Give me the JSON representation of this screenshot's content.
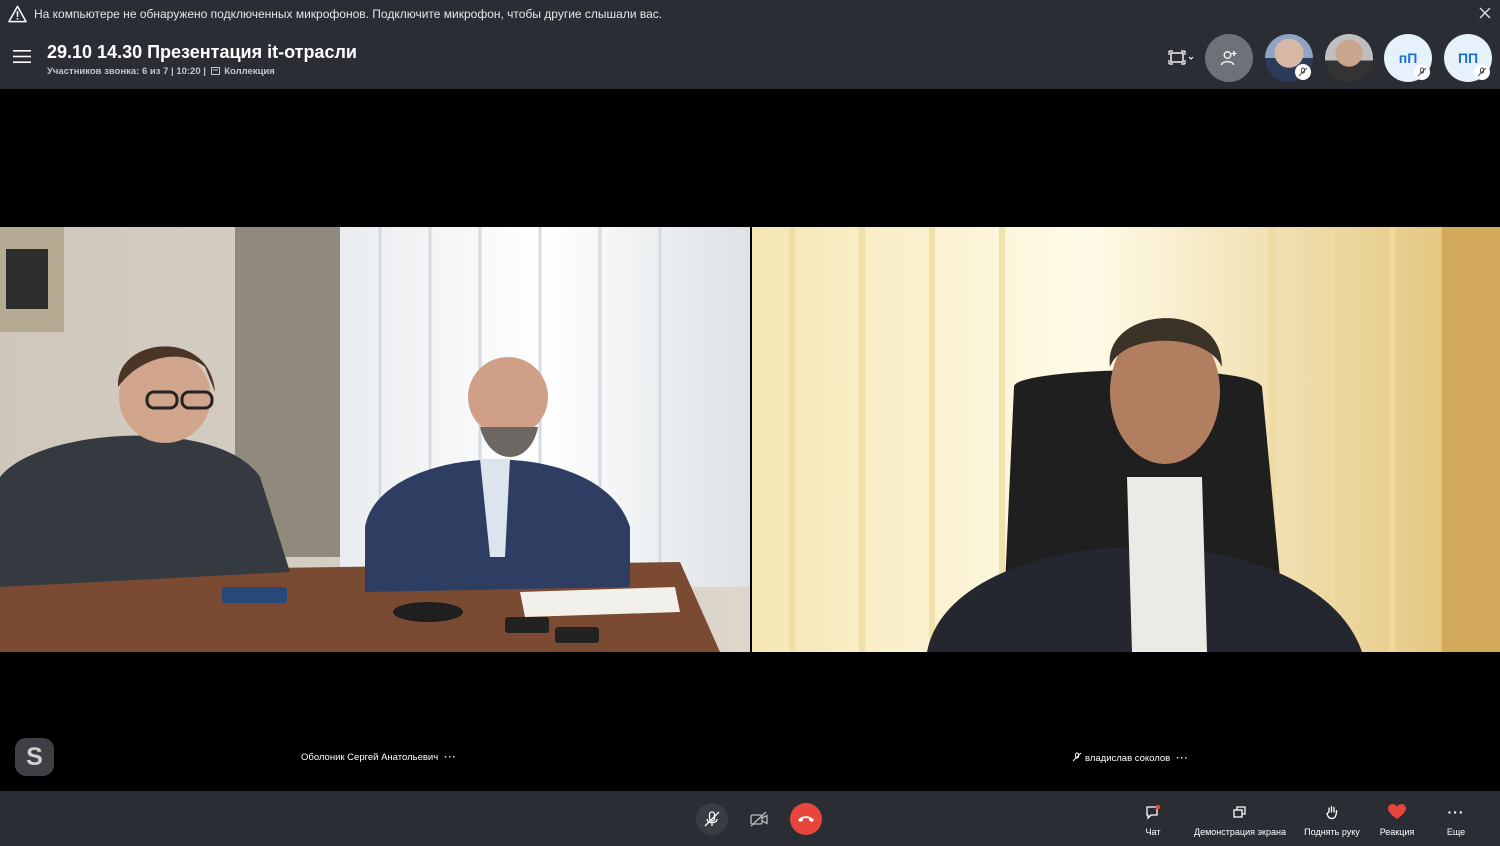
{
  "warning": {
    "text": "На компьютере не обнаружено подключенных микрофонов. Подключите микрофон, чтобы другие слышали вас."
  },
  "header": {
    "title": "29.10 14.30 Презентация it-отрасли",
    "participants": "Участников звонка: 6 из 7",
    "duration": "10:20",
    "collection": "Коллекция"
  },
  "participants": {
    "initials_1": "пП",
    "initials_2": "ПП"
  },
  "videos": {
    "left_name": "Оболоник Сергей Анатольевич",
    "right_name": "владислав соколов",
    "more": "···"
  },
  "skype_logo": "S",
  "toolbar": {
    "chat": "Чат",
    "share": "Демонстрация экрана",
    "raise_hand": "Поднять руку",
    "reaction": "Реакция",
    "more": "Еще",
    "more_glyph": "···"
  },
  "colors": {
    "bar": "#2b2d34",
    "hangup": "#e8453c",
    "reaction": "#e8453c",
    "initials_bg": "#e6f1fb",
    "initials_fg": "#1a6fd1"
  }
}
